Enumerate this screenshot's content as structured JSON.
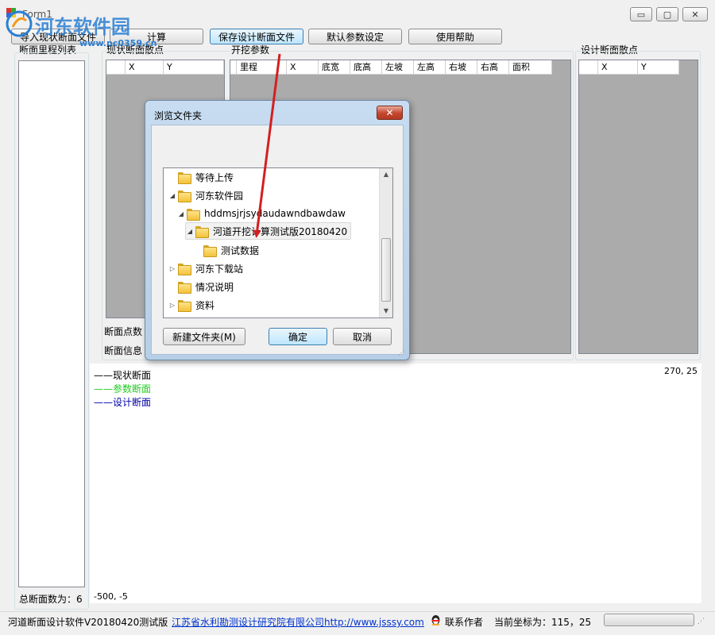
{
  "window": {
    "title": "Form1",
    "controls": {
      "minimize": "▭",
      "maximize": "▢",
      "close": "✕"
    }
  },
  "watermark": {
    "logo_text": "河东软件园",
    "url_text": "www.pc0359.cn"
  },
  "toolbar": {
    "import_label": "导入现状断面文件",
    "calc_label": "计算",
    "save_label": "保存设计断面文件",
    "defaults_label": "默认参数设定",
    "help_label": "使用帮助"
  },
  "panels": {
    "mileage_list_title": "断面里程列表",
    "current_points_title": "现状断面散点",
    "current_points_columns": [
      "X",
      "Y"
    ],
    "excavation_title": "开挖参数",
    "excavation_columns": [
      "里程",
      "X",
      "底宽",
      "底高",
      "左坡",
      "左高",
      "右坡",
      "右高",
      "面积"
    ],
    "design_points_title": "设计断面散点",
    "design_points_columns": [
      "X",
      "Y"
    ],
    "point_count_label": "断面点数",
    "section_info_label": "断面信息",
    "total_sections_label": "总断面数为：6"
  },
  "canvas": {
    "legend": [
      {
        "label": "——现状断面",
        "color": "#000000"
      },
      {
        "label": "——参数断面",
        "color": "#22cc22"
      },
      {
        "label": "——设计断面",
        "color": "#0000aa"
      }
    ],
    "top_right_coord": "270, 25",
    "bottom_left_coord": "-500, -5"
  },
  "dialog": {
    "title": "浏览文件夹",
    "close_symbol": "✕",
    "tree": [
      {
        "label": "等待上传",
        "level": 0,
        "expander": "",
        "selected": false
      },
      {
        "label": "河东软件园",
        "level": 0,
        "expander": "◢",
        "selected": false
      },
      {
        "label": "hddmsjrjsydaudawndbawdaw",
        "level": 1,
        "expander": "◢",
        "selected": false
      },
      {
        "label": "河道开挖计算测试版20180420",
        "level": 2,
        "expander": "◢",
        "selected": true
      },
      {
        "label": "测试数据",
        "level": 3,
        "expander": "",
        "selected": false
      },
      {
        "label": "河东下载站",
        "level": 0,
        "expander": "▷",
        "selected": false
      },
      {
        "label": "情况说明",
        "level": 0,
        "expander": "",
        "selected": false
      },
      {
        "label": "资料",
        "level": 0,
        "expander": "▷",
        "selected": false
      }
    ],
    "new_folder_label": "新建文件夹(M)",
    "ok_label": "确定",
    "cancel_label": "取消"
  },
  "statusbar": {
    "app_version": "河道断面设计软件V20180420测试版",
    "company_link": "江苏省水利勘测设计研究院有限公司http://www.jsssy.com",
    "contact_label": "联系作者",
    "coord_label": "当前坐标为：115，25"
  },
  "colors": {
    "annotation_arrow": "#d41f1f",
    "grid_background": "#ababab",
    "dialog_frame": "#b9d1ea"
  }
}
